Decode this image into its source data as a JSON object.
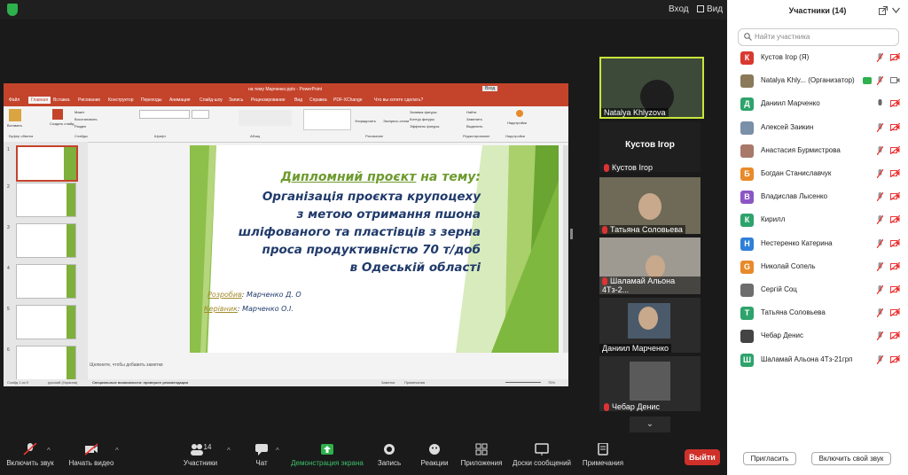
{
  "topbar": {
    "view_label": "Вид"
  },
  "ppt": {
    "title": "на тему Марченко.pptx  -  PowerPoint",
    "signin": "Вход",
    "tabs": [
      "Файл",
      "Главная",
      "Вставка",
      "Рисование",
      "Конструктор",
      "Переходы",
      "Анимация",
      "Слайд-шоу",
      "Запись",
      "Рецензирование",
      "Вид",
      "Справка",
      "PDF-XChange",
      "Что вы хотите сделать?"
    ],
    "ribbon_groups": [
      "Буфер обмена",
      "Слайды",
      "Шрифт",
      "Абзац",
      "Рисование",
      "Редактирование",
      "Надстройки"
    ],
    "ribbon_items": [
      "Вставить",
      "Создать слайд",
      "Макет",
      "Восстановить",
      "Раздел",
      "Упорядочить",
      "Экспресс-стили",
      "Заливка фигуры",
      "Контур фигуры",
      "Эффекты фигуры",
      "Найти",
      "Заменить",
      "Выделить",
      "Надстройки"
    ],
    "slide_numbers": [
      "1",
      "2",
      "3",
      "4",
      "5",
      "6"
    ],
    "slide": {
      "line1a": "Дипломний проєкт",
      "line1b": " на тему:",
      "lines": [
        "Організація проєкта крупоцеху",
        "з метою отримання пшона",
        "шліфованого та пластівців з зерна",
        "проса продуктивністю 70 т/доб",
        "в Одеській області"
      ],
      "author_label": "Розробив",
      "author": ": Марченко Д. О",
      "supervisor_label": "Керівник",
      "supervisor": ": Марченко О.І."
    },
    "notes": "Щелкните, чтобы добавить заметки",
    "status_left": "Слайд 1 из 9",
    "status_lang": "русский (Украина)",
    "status_access": "Специальные возможности: проверьте рекомендации",
    "status_notes": "Заметки",
    "status_comments": "Примечания",
    "zoom": "75%"
  },
  "videos": {
    "natalya": "Natalya Khlyzova",
    "active_header": "Кустов Ігор",
    "kustov": "Кустов Ігор",
    "tatyana": "Татьяна Соловьева",
    "shalamay": "Шаламай Альона 4Тз-2...",
    "danil": "Даниил Марченко",
    "chebar": "Чебар Денис"
  },
  "toolbar": {
    "mic": "Включить звук",
    "video": "Начать видео",
    "participants": "Участники",
    "participants_count": "14",
    "chat": "Чат",
    "share": "Демонстрация экрана",
    "record": "Запись",
    "reactions": "Реакции",
    "apps": "Приложения",
    "whiteboard": "Доски сообщений",
    "notes": "Примечания",
    "leave": "Выйти"
  },
  "panel": {
    "title": "Участники (14)",
    "search_placeholder": "Найти участника",
    "participants": [
      {
        "initial": "К",
        "name": "Кустов Ігор (Я)",
        "color": "#d9382f"
      },
      {
        "initial": "",
        "name": "Natalya Khly... (Организатор)",
        "color": "#8a7a5a"
      },
      {
        "initial": "Д",
        "name": "Даниил Марченко",
        "color": "#2ea36b"
      },
      {
        "initial": "",
        "name": "Алексей Заикин",
        "color": "#7a8fa8"
      },
      {
        "initial": "",
        "name": "Анастасия Бурмистрова",
        "color": "#a8786a"
      },
      {
        "initial": "Б",
        "name": "Богдан Станиславчук",
        "color": "#e88a2a"
      },
      {
        "initial": "В",
        "name": "Владислав Лысенко",
        "color": "#8b56c4"
      },
      {
        "initial": "К",
        "name": "Кирилл",
        "color": "#2ea36b"
      },
      {
        "initial": "Н",
        "name": "Нестеренко Катерина",
        "color": "#2f7fd8"
      },
      {
        "initial": "G",
        "name": "Николай Сопель",
        "color": "#e88a2a"
      },
      {
        "initial": "",
        "name": "Сергій Соц",
        "color": "#6d6d6d"
      },
      {
        "initial": "Т",
        "name": "Татьяна Соловьева",
        "color": "#2ea36b"
      },
      {
        "initial": "",
        "name": "Чебар Денис",
        "color": "#444444"
      },
      {
        "initial": "Ш",
        "name": "Шаламай Альона 4Тз-21грп",
        "color": "#2ea36b"
      }
    ],
    "invite": "Пригласить",
    "unmute": "Включить свой звук"
  }
}
